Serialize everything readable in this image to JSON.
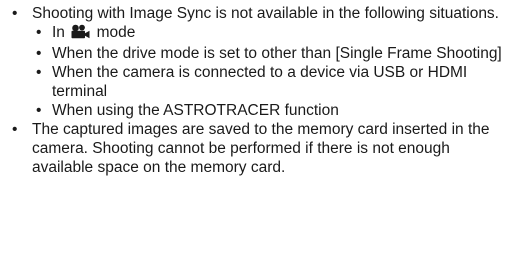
{
  "items": [
    {
      "text": "Shooting with Image Sync is not available in the following situations.",
      "sub": [
        {
          "before": "In",
          "icon": "movie-camera-icon",
          "after": "mode"
        },
        {
          "text": "When the drive mode is set to other than [Single Frame Shooting]"
        },
        {
          "text": "When the camera is connected to a device via USB or HDMI terminal"
        },
        {
          "text": "When using the ASTROTRACER function"
        }
      ]
    },
    {
      "text": "The captured images are saved to the memory card inserted in the camera. Shooting cannot be performed if there is not enough available space on the memory card."
    }
  ]
}
